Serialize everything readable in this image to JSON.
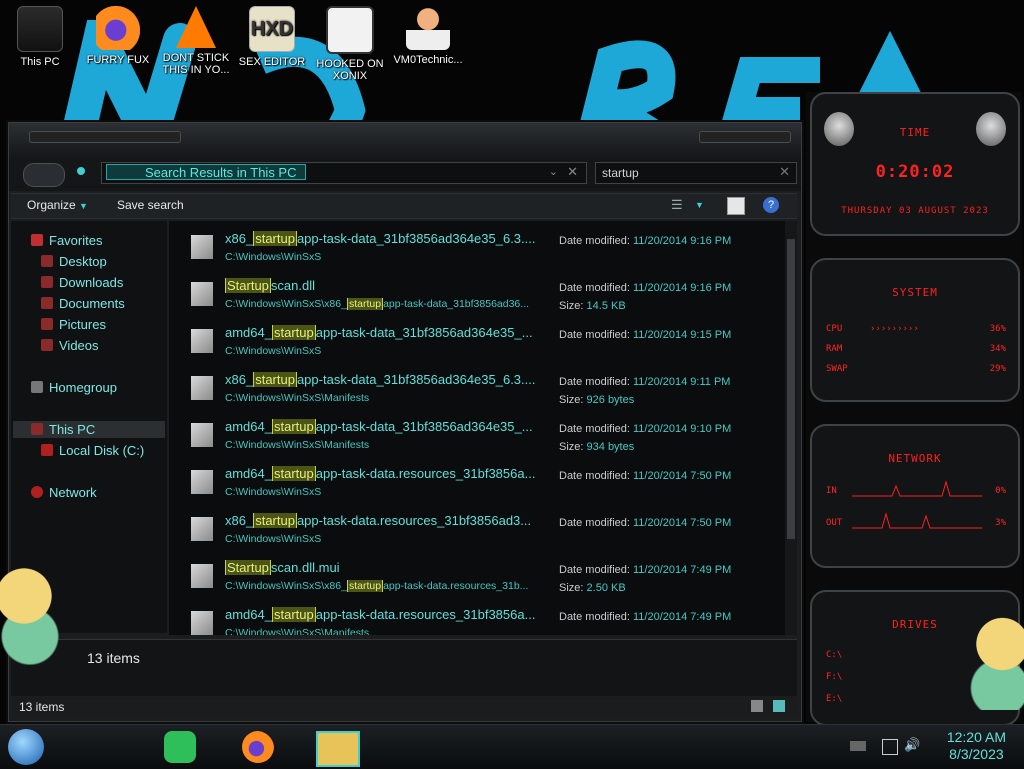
{
  "desktop": {
    "wallpaper_text": "NOT REACT",
    "icons": [
      {
        "label": "This PC",
        "icon": "this-pc-icon"
      },
      {
        "label": "FURRY FUX",
        "icon": "firefox-icon"
      },
      {
        "label": "DONT STICK THIS IN YO...",
        "icon": "vlc-cone-icon"
      },
      {
        "label": "SEX EDITOR",
        "icon": "hxd-editor-icon"
      },
      {
        "label": "HOOKED ON XONIX",
        "icon": "xonix-game-icon"
      },
      {
        "label": "VM0Technic...",
        "icon": "doctor-avatar-icon"
      }
    ]
  },
  "explorer": {
    "address": "Search Results in This PC",
    "search_value": "startup",
    "toolbar": {
      "organize": "Organize",
      "save_search": "Save search"
    },
    "nav": {
      "favorites": "Favorites",
      "desktop": "Desktop",
      "downloads": "Downloads",
      "documents": "Documents",
      "pictures": "Pictures",
      "videos": "Videos",
      "homegroup": "Homegroup",
      "this_pc": "This PC",
      "local_disk": "Local Disk (C:)",
      "network": "Network"
    },
    "results": [
      {
        "pre": "x86_",
        "hl": "startup",
        "post": "app-task-data_31bf3856ad364e35_6.3....",
        "path_pre": "C:\\Windows\\WinSxS",
        "path_hl": "",
        "path_post": "",
        "m1l": "Date modified:",
        "m1": "11/20/2014 9:16 PM",
        "m2l": "",
        "m2": ""
      },
      {
        "pre": "",
        "hl": "Startup",
        "post": "scan.dll",
        "path_pre": "C:\\Windows\\WinSxS\\x86_",
        "path_hl": "startup",
        "path_post": "app-task-data_31bf3856ad36...",
        "m1l": "Date modified:",
        "m1": "11/20/2014 9:16 PM",
        "m2l": "Size:",
        "m2": "14.5 KB"
      },
      {
        "pre": "amd64_",
        "hl": "startup",
        "post": "app-task-data_31bf3856ad364e35_...",
        "path_pre": "C:\\Windows\\WinSxS",
        "path_hl": "",
        "path_post": "",
        "m1l": "Date modified:",
        "m1": "11/20/2014 9:15 PM",
        "m2l": "",
        "m2": ""
      },
      {
        "pre": "x86_",
        "hl": "startup",
        "post": "app-task-data_31bf3856ad364e35_6.3....",
        "path_pre": "C:\\Windows\\WinSxS\\Manifests",
        "path_hl": "",
        "path_post": "",
        "m1l": "Date modified:",
        "m1": "11/20/2014 9:11 PM",
        "m2l": "Size:",
        "m2": "926 bytes"
      },
      {
        "pre": "amd64_",
        "hl": "startup",
        "post": "app-task-data_31bf3856ad364e35_...",
        "path_pre": "C:\\Windows\\WinSxS\\Manifests",
        "path_hl": "",
        "path_post": "",
        "m1l": "Date modified:",
        "m1": "11/20/2014 9:10 PM",
        "m2l": "Size:",
        "m2": "934 bytes"
      },
      {
        "pre": "amd64_",
        "hl": "startup",
        "post": "app-task-data.resources_31bf3856a...",
        "path_pre": "C:\\Windows\\WinSxS",
        "path_hl": "",
        "path_post": "",
        "m1l": "Date modified:",
        "m1": "11/20/2014 7:50 PM",
        "m2l": "",
        "m2": ""
      },
      {
        "pre": "x86_",
        "hl": "startup",
        "post": "app-task-data.resources_31bf3856ad3...",
        "path_pre": "C:\\Windows\\WinSxS",
        "path_hl": "",
        "path_post": "",
        "m1l": "Date modified:",
        "m1": "11/20/2014 7:50 PM",
        "m2l": "",
        "m2": ""
      },
      {
        "pre": "",
        "hl": "Startup",
        "post": "scan.dll.mui",
        "path_pre": "C:\\Windows\\WinSxS\\x86_",
        "path_hl": "startup",
        "path_post": "app-task-data.resources_31b...",
        "m1l": "Date modified:",
        "m1": "11/20/2014 7:49 PM",
        "m2l": "Size:",
        "m2": "2.50 KB"
      },
      {
        "pre": "amd64_",
        "hl": "startup",
        "post": "app-task-data.resources_31bf3856a...",
        "path_pre": "C:\\Windows\\WinSxS\\Manifests",
        "path_hl": "",
        "path_post": "",
        "m1l": "Date modified:",
        "m1": "11/20/2014 7:49 PM",
        "m2l": "",
        "m2": ""
      }
    ],
    "details_count": "13 items",
    "status_count": "13 items"
  },
  "gadget": {
    "time_title": "TIME",
    "time": "0:20:02",
    "date": "THURSDAY 03 AUGUST 2023",
    "system_title": "SYSTEM",
    "cpu_label": "CPU",
    "cpu_val": "36%",
    "ram_label": "RAM",
    "ram_val": "34%",
    "swap_label": "SWAP",
    "swap_val": "29%",
    "network_title": "NETWORK",
    "in_label": "IN",
    "in_val": "0%",
    "out_label": "OUT",
    "out_val": "3%",
    "drives_title": "DRIVES",
    "drive_c": "C:\\",
    "drive_f": "F:\\",
    "drive_e": "E:\\",
    "accent": "#ff2020"
  },
  "taskbar": {
    "apps": [
      "chat-app-icon",
      "firefox-icon",
      "file-explorer-icon"
    ],
    "time": "12:20 AM",
    "date": "8/3/2023"
  },
  "colors": {
    "accent": "#5fe0dc",
    "highlight": "#c9d43a",
    "red": "#ff2020"
  }
}
